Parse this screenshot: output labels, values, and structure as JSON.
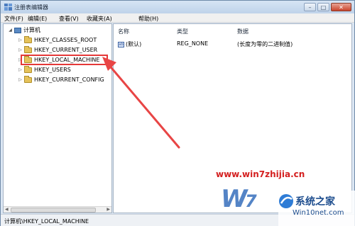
{
  "window": {
    "title": "注册表编辑器",
    "buttons": {
      "minimize": "–",
      "maximize": "□",
      "close": "✕"
    }
  },
  "menu": [
    "文件(F)",
    "编辑(E)",
    "查看(V)",
    "收藏夹(A)",
    "帮助(H)"
  ],
  "tree": {
    "root": "计算机",
    "items": [
      {
        "label": "HKEY_CLASSES_ROOT"
      },
      {
        "label": "HKEY_CURRENT_USER"
      },
      {
        "label": "HKEY_LOCAL_MACHINE",
        "highlighted": true
      },
      {
        "label": "HKEY_USERS"
      },
      {
        "label": "HKEY_CURRENT_CONFIG"
      }
    ]
  },
  "columns": {
    "name": "名称",
    "type": "类型",
    "data": "数据"
  },
  "values": [
    {
      "icon": "ab",
      "name": "(默认)",
      "type": "REG_NONE",
      "data": "(长度为零的二进制值)"
    }
  ],
  "status": "计算机\\HKEY_LOCAL_MACHINE",
  "watermark": {
    "url": "www.win7zhijia.cn",
    "badge_title": "系统之家",
    "badge_sub": "Win10net.com"
  },
  "colors": {
    "highlight": "#e53838",
    "watermark_red": "#d41f1f",
    "watermark_blue": "#1d4d8e"
  }
}
